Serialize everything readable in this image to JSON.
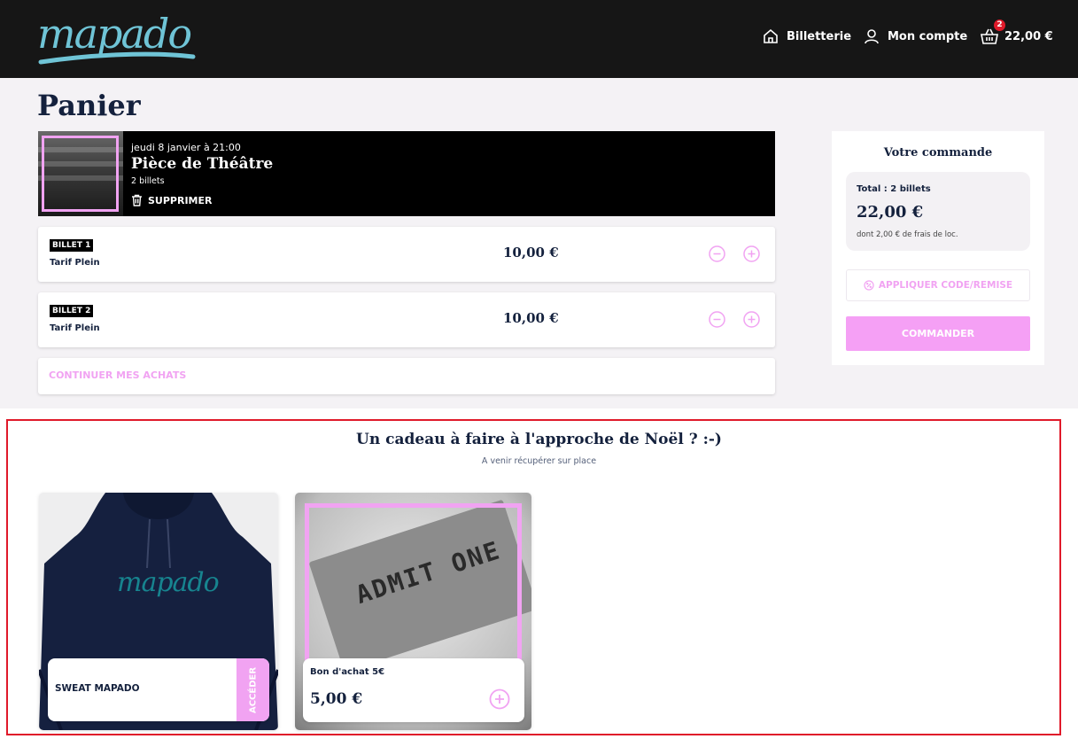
{
  "header": {
    "logo_text": "mapado",
    "nav": {
      "billetterie": "Billetterie",
      "account": "Mon compte",
      "cart_total": "22,00 €",
      "cart_count": "2"
    }
  },
  "page": {
    "title": "Panier"
  },
  "event": {
    "date": "jeudi 8 janvier à 21:00",
    "name": "Pièce de Théâtre",
    "tickets": "2 billets",
    "delete_label": "SUPPRIMER"
  },
  "tickets": [
    {
      "tag": "BILLET 1",
      "tarif": "Tarif Plein",
      "price": "10,00 €"
    },
    {
      "tag": "BILLET 2",
      "tarif": "Tarif Plein",
      "price": "10,00 €"
    }
  ],
  "continue_label": "CONTINUER MES ACHATS",
  "order": {
    "title": "Votre commande",
    "total_label": "Total : 2 billets",
    "total_amount": "22,00 €",
    "fee_note": "dont 2,00 € de frais de loc.",
    "coupon_label": "APPLIQUER CODE/REMISE",
    "order_button": "COMMANDER"
  },
  "gift": {
    "title": "Un cadeau à faire à l'approche de Noël ? :-)",
    "subtitle": "A venir récupérer sur place",
    "products": [
      {
        "name": "SWEAT MAPADO",
        "action": "ACCÉDER",
        "image_text": "mapado"
      },
      {
        "name": "Bon d'achat 5€",
        "price": "5,00 €",
        "image_text": "ADMIT ONE"
      }
    ]
  },
  "colors": {
    "accent_pink": "#f1a3f2",
    "header_bg": "#161616",
    "highlight_red": "#e01a2a",
    "logo_blue": "#6fc4d6"
  }
}
